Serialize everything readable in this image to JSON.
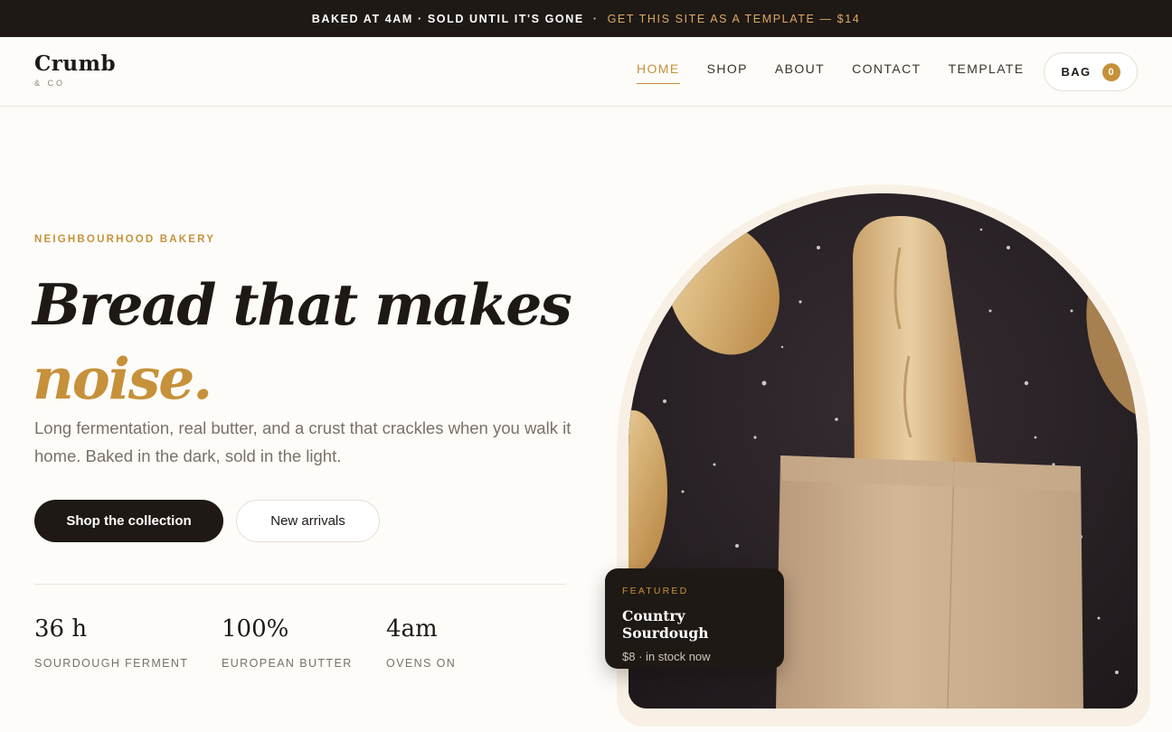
{
  "announcement": {
    "text": "BAKED AT 4AM · SOLD UNTIL IT'S GONE",
    "separator": "·",
    "link": "GET THIS SITE AS A TEMPLATE — $14"
  },
  "header": {
    "logo_name": "Crumb",
    "logo_sub": "& CO",
    "nav": [
      {
        "label": "HOME",
        "active": true
      },
      {
        "label": "SHOP"
      },
      {
        "label": "ABOUT"
      },
      {
        "label": "CONTACT"
      },
      {
        "label": "TEMPLATE"
      }
    ],
    "bag_label": "BAG",
    "bag_count": "0"
  },
  "hero": {
    "eyebrow": "NEIGHBOURHOOD BAKERY",
    "headline_line1": "Bread that makes",
    "headline_line2": "noise.",
    "lede": "Long fermentation, real butter, and a crust that crackles when you walk it home. Baked in the dark, sold in the light.",
    "primary_cta": "Shop the collection",
    "secondary_cta": "New arrivals",
    "stats": [
      {
        "value": "36 h",
        "label": "SOURDOUGH FERMENT"
      },
      {
        "value": "100%",
        "label": "EUROPEAN BUTTER"
      },
      {
        "value": "4am",
        "label": "OVENS ON"
      }
    ]
  },
  "featured": {
    "tag": "FEATURED",
    "name": "Country Sourdough",
    "meta": "$8 · in stock now"
  },
  "colors": {
    "accent": "#c6913a",
    "dark": "#1e1915",
    "background": "#fdfcf9",
    "muted": "#7a7066"
  }
}
